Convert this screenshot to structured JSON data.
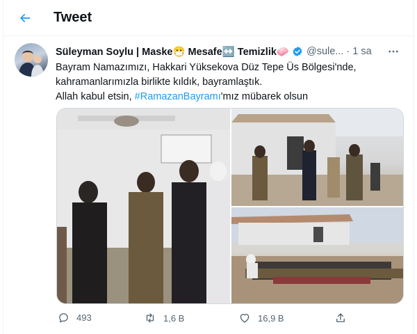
{
  "header": {
    "title": "Tweet",
    "back_icon": "arrow-left-icon"
  },
  "tweet": {
    "author_name": "Süleyman Soylu | Maske😷 Mesafe↔️ Temizlik🧼",
    "verified": true,
    "handle": "@sule...",
    "separator": "·",
    "time": "1 sa",
    "text_line1": "Bayram Namazımızı, Hakkari Yüksekova Düz Tepe Üs Bölgesi'nde,",
    "text_line2": "kahramanlarımızla birlikte kıldık, bayramlaştık.",
    "text_line3_prefix": "Allah kabul etsin, ",
    "hashtag": "#RamazanBayramı",
    "text_line3_suffix": "'mız mübarek olsun",
    "counts": {
      "replies": "493",
      "retweets": "1,6 B",
      "likes": "16,9 B"
    }
  },
  "colors": {
    "accent": "#1d9bf0",
    "text": "#0f1419",
    "secondary": "#536471",
    "border": "#eff3f4"
  },
  "icons": [
    "arrow-left-icon",
    "verified-badge-icon",
    "more-icon",
    "reply-icon",
    "retweet-icon",
    "like-icon",
    "share-icon"
  ]
}
